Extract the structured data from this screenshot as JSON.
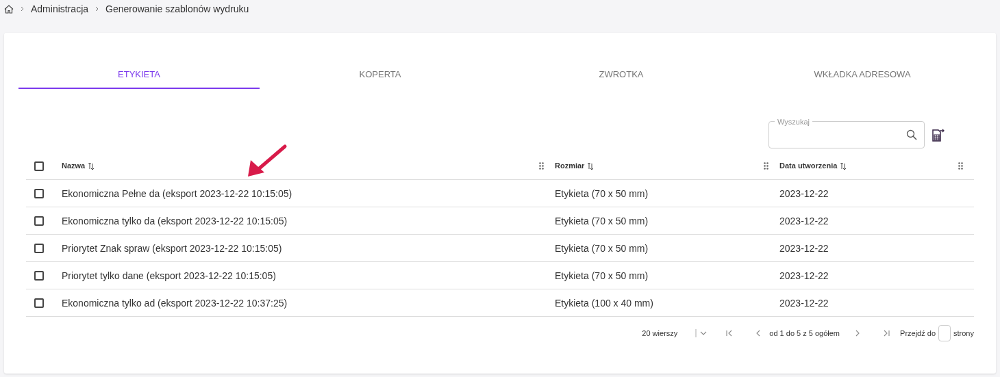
{
  "breadcrumbs": [
    "Administracja",
    "Generowanie szablonów wydruku"
  ],
  "tabs": [
    {
      "label": "ETYKIETA",
      "selected": true
    },
    {
      "label": "KOPERTA",
      "selected": false
    },
    {
      "label": "ZWROTKA",
      "selected": false
    },
    {
      "label": "WKŁADKA ADRESOWA",
      "selected": false
    }
  ],
  "search": {
    "label": "Wyszukaj"
  },
  "table": {
    "select_all_checked": false,
    "columns": [
      "Nazwa",
      "Rozmiar",
      "Data utworzenia"
    ],
    "rows": [
      {
        "checked": false,
        "cells": [
          "Ekonomiczna Pełne da (eksport 2023-12-22 10:15:05)",
          "Etykieta (70 x 50 mm)",
          "2023-12-22"
        ]
      },
      {
        "checked": false,
        "cells": [
          "Ekonomiczna tylko da (eksport 2023-12-22 10:15:05)",
          "Etykieta (70 x 50 mm)",
          "2023-12-22"
        ]
      },
      {
        "checked": false,
        "cells": [
          "Priorytet Znak spraw (eksport 2023-12-22 10:15:05)",
          "Etykieta (70 x 50 mm)",
          "2023-12-22"
        ]
      },
      {
        "checked": false,
        "cells": [
          "Priorytet tylko dane (eksport 2023-12-22 10:15:05)",
          "Etykieta (70 x 50 mm)",
          "2023-12-22"
        ]
      },
      {
        "checked": false,
        "cells": [
          "Ekonomiczna tylko ad (eksport 2023-12-22 10:37:25)",
          "Etykieta (100 x 40 mm)",
          "2023-12-22"
        ]
      }
    ]
  },
  "pagination": {
    "rows_per_page": "20 wierszy",
    "range": "od 1 do 5 z 5 ogółem",
    "goto_label": "Przejdź do",
    "goto_suffix": "strony"
  },
  "annotations": [
    {
      "kind": "arrow",
      "color": "#d81b4a"
    }
  ]
}
